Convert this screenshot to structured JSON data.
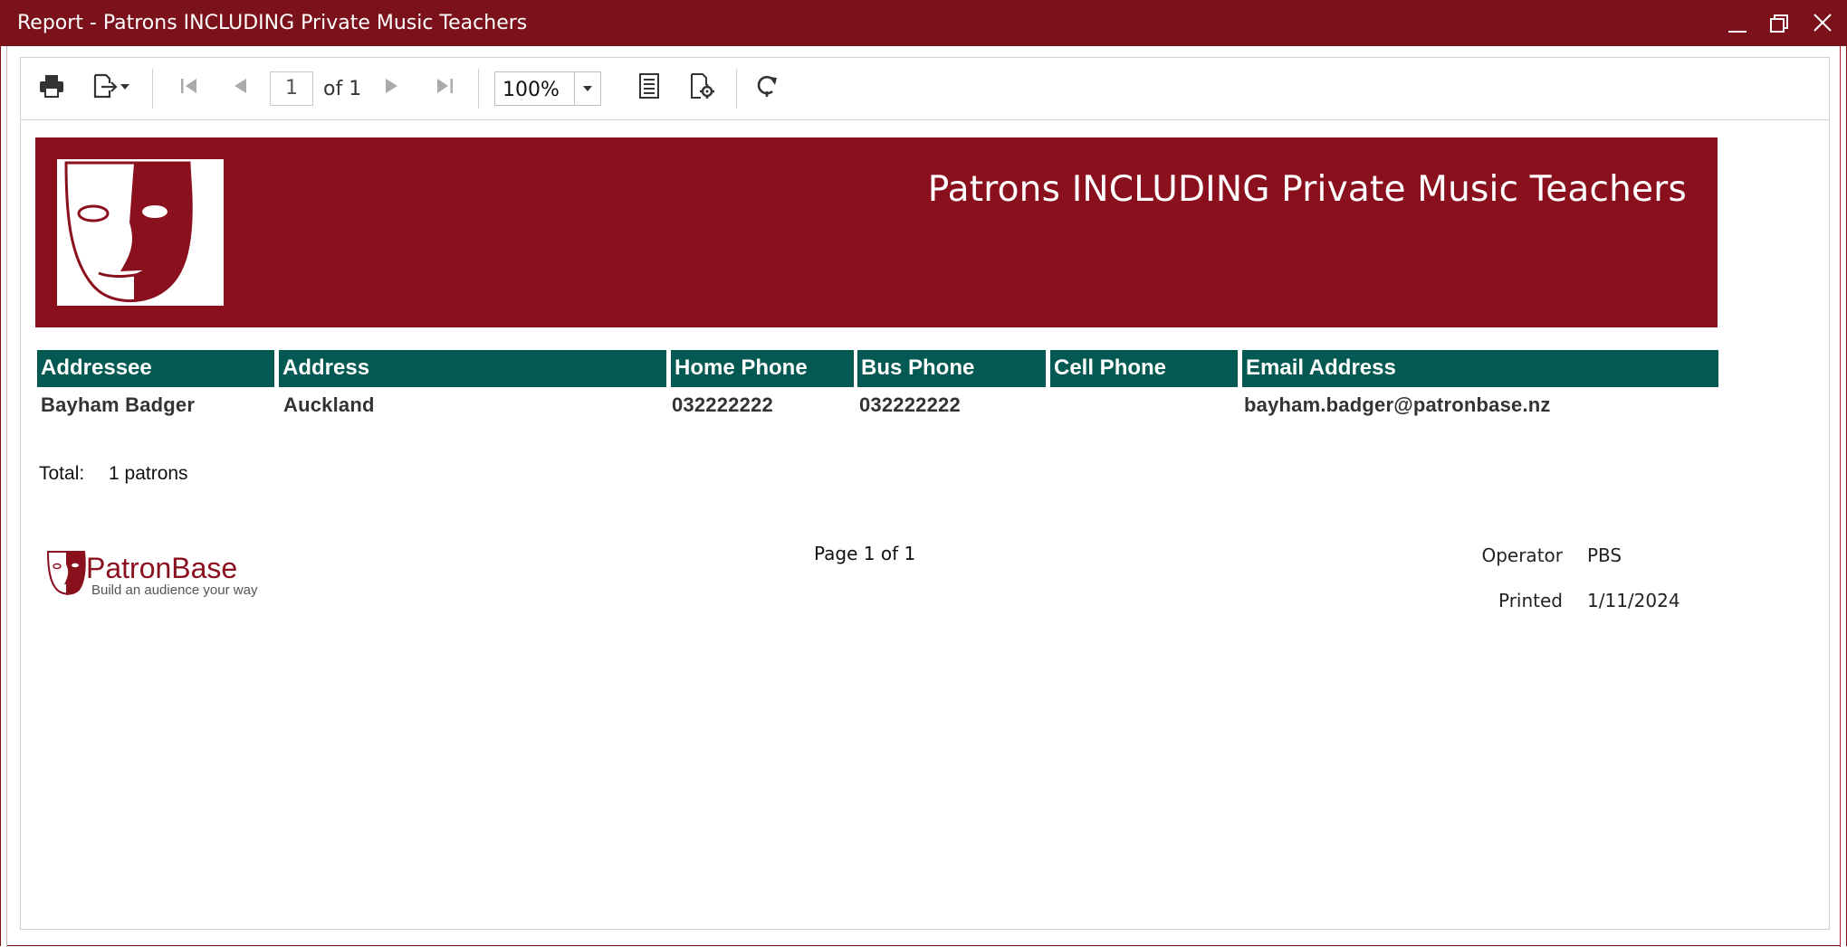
{
  "window": {
    "title": "Report - Patrons  INCLUDING Private Music Teachers",
    "title_bar_color": "#7b111a"
  },
  "toolbar": {
    "page_number": "1",
    "page_of": "of 1",
    "zoom": "100%",
    "icons": [
      "print-icon",
      "export-icon",
      "dropdown-arrow-icon",
      "first-page-icon",
      "previous-page-icon",
      "next-page-icon",
      "last-page-icon",
      "zoom-dropdown-icon",
      "single-page-view-icon",
      "page-setup-icon",
      "refresh-icon"
    ]
  },
  "report": {
    "title": "Patrons  INCLUDING Private Music Teachers",
    "header_color": "#8a101e",
    "table_header_color": "#045a52",
    "columns": [
      "Addressee",
      "Address",
      "Home Phone",
      "Bus Phone",
      "Cell Phone",
      "Email Address"
    ],
    "rows": [
      [
        "Bayham Badger",
        "Auckland",
        "032222222",
        "032222222",
        "",
        "bayham.badger@patronbase.nz"
      ]
    ],
    "total_label": "Total:",
    "total_value": "1 patrons"
  },
  "footer": {
    "brand": "PatronBase",
    "tagline": "Build an audience your way",
    "page_info": "Page 1 of 1",
    "operator_label": "Operator",
    "operator_value": "PBS",
    "printed_label": "Printed",
    "printed_value": "1/11/2024"
  }
}
